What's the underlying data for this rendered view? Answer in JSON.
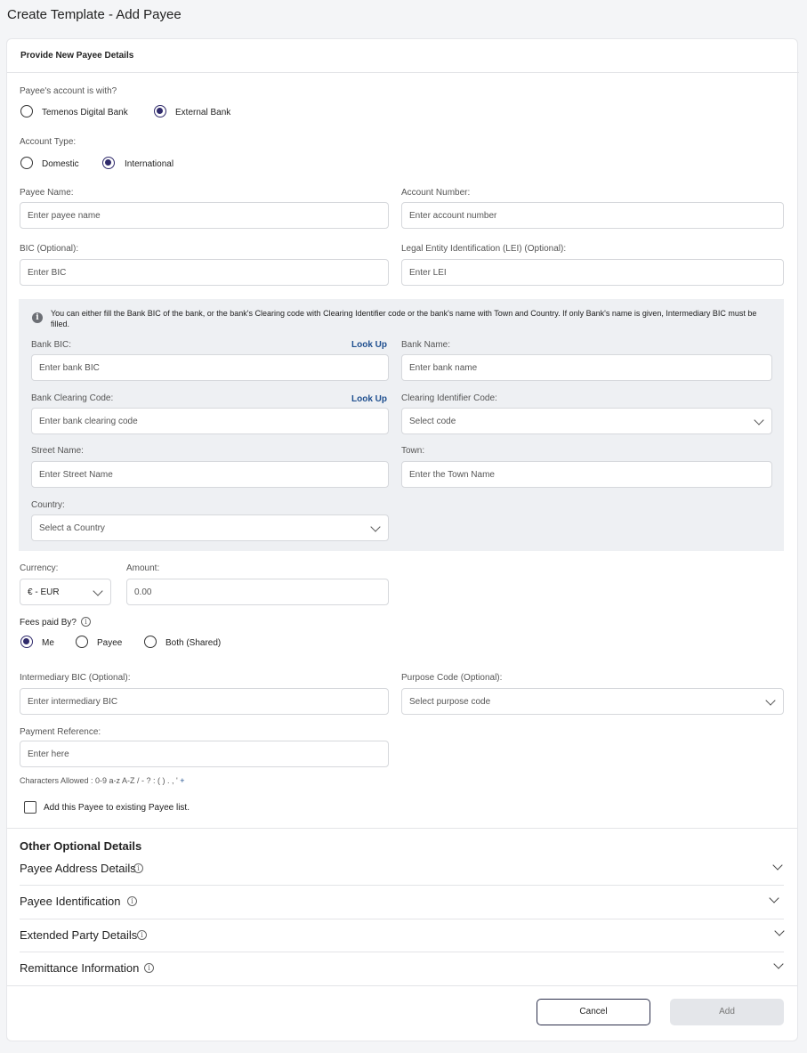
{
  "page_title": "Create Template - Add Payee",
  "card_title": "Provide New Payee Details",
  "account_with": {
    "label": "Payee's account is with?",
    "options": [
      {
        "label": "Temenos Digital Bank",
        "selected": false
      },
      {
        "label": "External Bank",
        "selected": true
      }
    ]
  },
  "account_type": {
    "label": "Account Type:",
    "options": [
      {
        "label": "Domestic",
        "selected": false
      },
      {
        "label": "International",
        "selected": true
      }
    ]
  },
  "fields": {
    "payee_name": {
      "label": "Payee Name:",
      "placeholder": "Enter payee name"
    },
    "account_number": {
      "label": "Account Number:",
      "placeholder": "Enter account number"
    },
    "bic": {
      "label": "BIC (Optional):",
      "placeholder": "Enter BIC"
    },
    "lei": {
      "label": "Legal Entity Identification (LEI) (Optional):",
      "placeholder": "Enter LEI"
    }
  },
  "bank_info": {
    "note": "You can either fill the Bank BIC of the bank, or the bank's Clearing code with Clearing Identifier code or the bank's name with Town and Country. If only Bank's name is given, Intermediary BIC must be filled.",
    "bank_bic": {
      "label": "Bank BIC:",
      "placeholder": "Enter bank BIC",
      "lookup": "Look Up"
    },
    "bank_name": {
      "label": "Bank Name:",
      "placeholder": "Enter bank name"
    },
    "clearing_code": {
      "label": "Bank Clearing Code:",
      "placeholder": "Enter bank clearing code",
      "lookup": "Look Up"
    },
    "clearing_id": {
      "label": "Clearing Identifier Code:",
      "value": "Select code"
    },
    "street": {
      "label": "Street Name:",
      "placeholder": "Enter Street Name"
    },
    "town": {
      "label": "Town:",
      "placeholder": "Enter the Town Name"
    },
    "country": {
      "label": "Country:",
      "value": "Select a Country"
    }
  },
  "currency": {
    "label": "Currency:",
    "value": "€ - EUR"
  },
  "amount": {
    "label": "Amount:",
    "placeholder": "0.00"
  },
  "fees": {
    "label": "Fees paid By?",
    "options": [
      {
        "label": "Me",
        "selected": true
      },
      {
        "label": "Payee",
        "selected": false
      },
      {
        "label": "Both (Shared)",
        "selected": false
      }
    ]
  },
  "intermediary_bic": {
    "label": "Intermediary BIC (Optional):",
    "placeholder": "Enter intermediary BIC"
  },
  "purpose_code": {
    "label": "Purpose Code (Optional):",
    "value": "Select purpose code"
  },
  "payment_reference": {
    "label": "Payment Reference:",
    "placeholder": "Enter here"
  },
  "chars_allowed": {
    "prefix": "Characters Allowed : 0-9 a-z A-Z / - ? : ( ) . , ' ",
    "plus": "+"
  },
  "add_to_list": {
    "label": "Add this Payee to existing Payee list.",
    "checked": false
  },
  "optional": {
    "title": "Other Optional Details",
    "sections": [
      {
        "label": "Payee Address Details"
      },
      {
        "label": "Payee Identification"
      },
      {
        "label": "Extended Party Details"
      },
      {
        "label": "Remittance Information"
      }
    ]
  },
  "buttons": {
    "cancel": "Cancel",
    "add": "Add"
  },
  "colors": {
    "accent": "#2f2a6b",
    "link": "#1f4f8f",
    "info_bg": "#eef0f3",
    "disabled_bg": "#e4e6ea"
  }
}
